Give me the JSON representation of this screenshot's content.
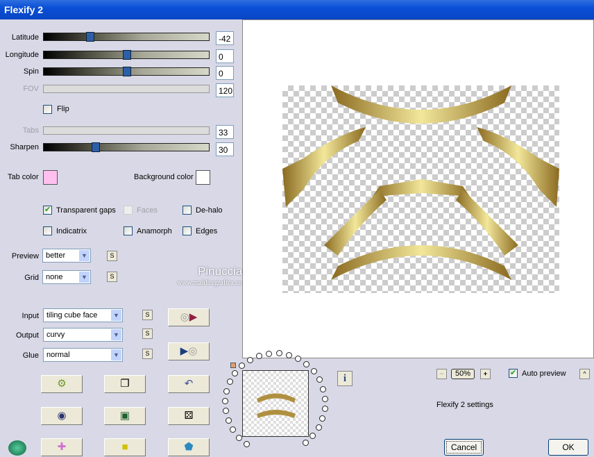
{
  "window": {
    "title": "Flexify 2"
  },
  "sliders": [
    {
      "label": "Latitude",
      "value": "-42",
      "position": 0.28,
      "enabled": true
    },
    {
      "label": "Longitude",
      "value": "0",
      "position": 0.5,
      "enabled": true
    },
    {
      "label": "Spin",
      "value": "0",
      "position": 0.5,
      "enabled": true
    },
    {
      "label": "FOV",
      "value": "120",
      "enabled": false
    },
    {
      "label": "Tabs",
      "value": "33",
      "enabled": false
    },
    {
      "label": "Sharpen",
      "value": "30",
      "position": 0.31,
      "enabled": true
    }
  ],
  "flip": {
    "label": "Flip",
    "checked": false
  },
  "colors": {
    "tab_label": "Tab color",
    "tab": "#ffc0f0",
    "bg_label": "Background color",
    "bg": "#ffffff"
  },
  "options": [
    {
      "label": "Transparent gaps",
      "checked": true,
      "enabled": true
    },
    {
      "label": "Faces",
      "checked": false,
      "enabled": false
    },
    {
      "label": "De-halo",
      "checked": false,
      "enabled": true
    },
    {
      "label": "Indicatrix",
      "checked": false,
      "enabled": true
    },
    {
      "label": "Anamorph",
      "checked": false,
      "enabled": true
    },
    {
      "label": "Edges",
      "checked": false,
      "enabled": true
    }
  ],
  "preview_select": {
    "label": "Preview",
    "value": "better"
  },
  "grid_select": {
    "label": "Grid",
    "value": "none"
  },
  "input_select": {
    "label": "Input",
    "value": "tiling cube face"
  },
  "output_select": {
    "label": "Output",
    "value": "curvy"
  },
  "glue_select": {
    "label": "Glue",
    "value": "normal"
  },
  "s_label": "S",
  "watermark": {
    "name": "Pinuccia",
    "url": "www.maidiregrafica.eu"
  },
  "zoom": {
    "minus": "−",
    "value": "50%",
    "plus": "+"
  },
  "auto_preview": {
    "label": "Auto preview",
    "checked": true
  },
  "collapse_label": "^",
  "settings_label": "Flexify 2 settings",
  "info_label": "i",
  "cancel_label": "Cancel",
  "ok_label": "OK"
}
